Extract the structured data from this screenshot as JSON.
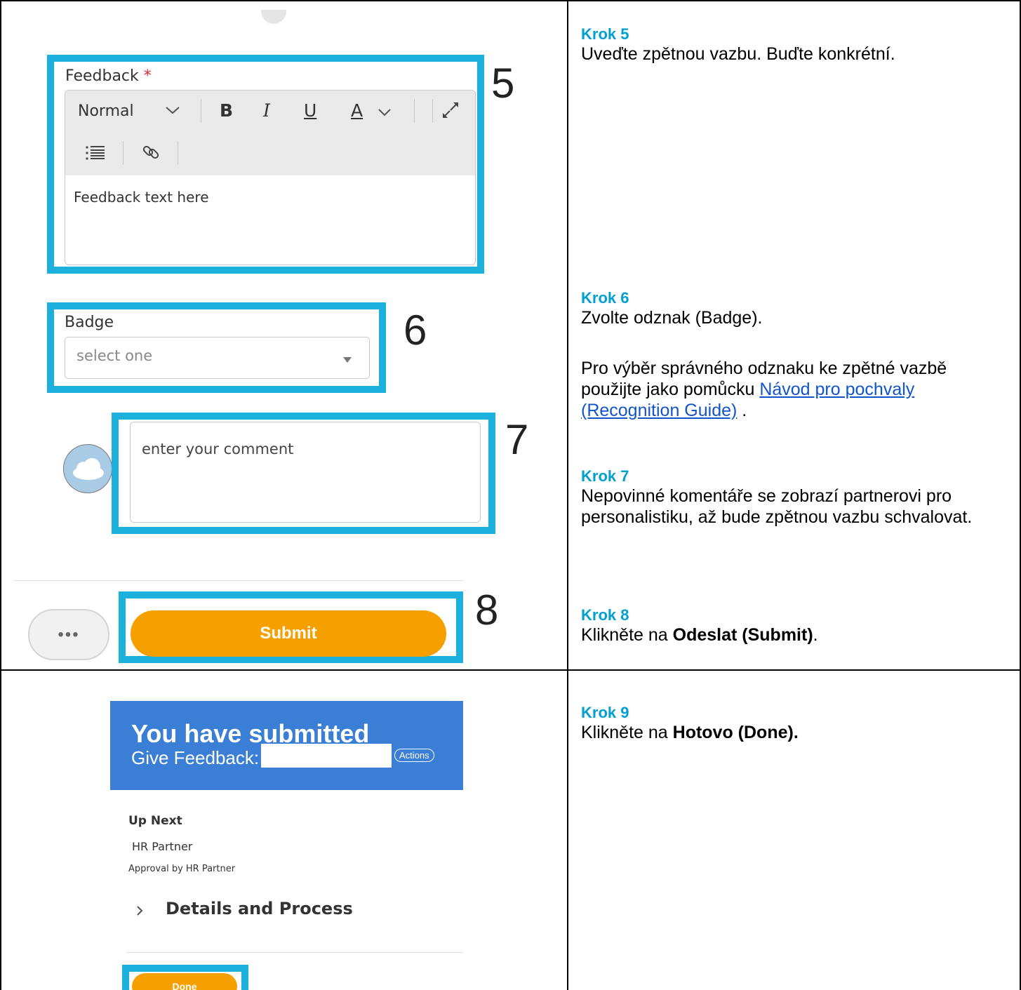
{
  "steps": [
    {
      "title": "Krok 5",
      "text": "Uveďte zpětnou vazbu. Buďte konkrétní."
    },
    {
      "title": "Krok 6",
      "text": "Zvolte odznak (Badge).",
      "para2_pre": "Pro výběr správného odznaku ke zpětné vazbě použijte jako pomůcku ",
      "para2_link": "Návod pro pochvaly (Recognition Guide)",
      "para2_post": " ."
    },
    {
      "title": "Krok 7",
      "text": "Nepovinné komentáře se zobrazí partnerovi pro personalistiku, až bude zpětnou vazbu schvalovat."
    },
    {
      "title": "Krok 8",
      "text_pre": "Klikněte na ",
      "text_bold": "Odeslat (Submit)",
      "text_post": "."
    },
    {
      "title": "Krok 9",
      "text_pre": "Klikněte na ",
      "text_bold": "Hotovo (Done)."
    }
  ],
  "markers": {
    "m5": "5",
    "m6": "6",
    "m7": "7",
    "m8": "8"
  },
  "feedback": {
    "label": "Feedback",
    "required_mark": "*",
    "style_select": "Normal",
    "bold": "B",
    "italic": "I",
    "underline": "U",
    "font_color": "A",
    "value": "Feedback text here"
  },
  "badge": {
    "label": "Badge",
    "placeholder": "select one"
  },
  "comment": {
    "placeholder": "enter your comment"
  },
  "footer": {
    "more": "•••",
    "submit": "Submit"
  },
  "confirmation": {
    "title": "You have submitted",
    "subtitle": "Give Feedback:",
    "actions": "Actions",
    "up_next": "Up Next",
    "up_next_item": "HR Partner",
    "up_next_sub": "Approval by HR Partner",
    "details": "Details and Process",
    "done": "Done"
  },
  "colors": {
    "highlight": "#1cb0dc",
    "step_title": "#00a0d2",
    "submit": "#f6a000",
    "banner": "#3a7fd5",
    "link": "#1155cc"
  }
}
